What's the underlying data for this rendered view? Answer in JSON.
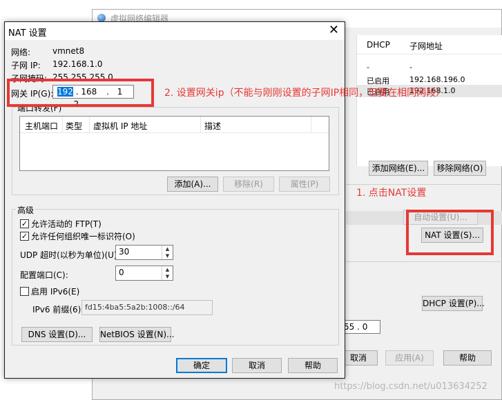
{
  "editor": {
    "title": "虚拟网络编辑器",
    "table": {
      "headers": [
        "DHCP",
        "子网地址"
      ],
      "rows": [
        [
          "-",
          "-"
        ],
        [
          "已启用",
          "192.168.196.0"
        ],
        [
          "已启用",
          "192.168.1.0"
        ]
      ]
    },
    "add_network": "添加网络(E)...",
    "remove_network": "移除网络(O)",
    "auto_settings": "自动设置(U)...",
    "nat_settings": "NAT 设置(S)...",
    "dhcp_settings": "DHCP 设置(P)...",
    "subnet_mask_tail": "55 . 0",
    "cancel": "取消",
    "apply": "应用(A)",
    "help": "帮助"
  },
  "nat": {
    "title": "NAT 设置",
    "close_glyph": "✕",
    "network_label": "网络:",
    "network_value": "vmnet8",
    "subnet_ip_label": "子网 IP:",
    "subnet_ip_value": "192.168.1.0",
    "subnet_mask_label": "子网掩码:",
    "subnet_mask_value": "255.255.255.0",
    "gateway_label": "网关 IP(G):",
    "gateway_segments": [
      "192",
      "168",
      "1",
      "2"
    ],
    "gateway_dots": [
      ".",
      ".",
      "."
    ],
    "port_forward_label": "端口转发(F)",
    "port_columns": [
      "主机端口",
      "类型",
      "虚拟机 IP 地址",
      "描述"
    ],
    "add": "添加(A)...",
    "remove": "移除(R)",
    "properties": "属性(P)",
    "advanced_label": "高级",
    "allow_ftp": "允许活动的 FTP(T)",
    "allow_ftp_checked": true,
    "allow_ouid": "允许任何组织唯一标识符(O)",
    "allow_ouid_checked": true,
    "udp_timeout_label": "UDP 超时(以秒为单位)(U):",
    "udp_timeout_value": "30",
    "config_port_label": "配置端口(C):",
    "config_port_value": "0",
    "enable_ipv6": "启用 IPv6(E)",
    "enable_ipv6_checked": false,
    "ipv6_prefix_label": "IPv6 前缀(6):",
    "ipv6_prefix_value": "fd15:4ba5:5a2b:1008::/64",
    "dns_settings": "DNS 设置(D)...",
    "netbios_settings": "NetBIOS 设置(N)...",
    "ok": "确定",
    "cancel": "取消",
    "help": "帮助"
  },
  "annotations": {
    "step1": "1. 点击NAT设置",
    "step2": "2. 设置网关ip（不能与刚刚设置的子网IP相同，但要在相同网段）",
    "watermark": "https://blog.csdn.net/u013634252",
    "color": "#e53935"
  },
  "icons": {
    "app_icon": "globe-icon",
    "check": "✓",
    "spin_up": "▲",
    "spin_down": "▼"
  }
}
